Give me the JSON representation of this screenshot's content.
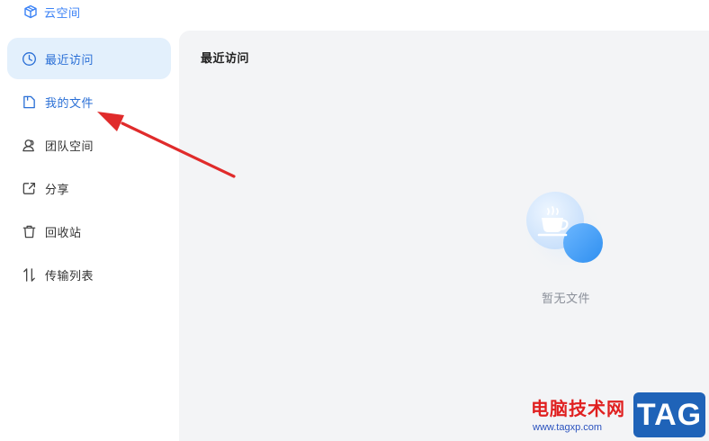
{
  "brand": {
    "title": "云空间",
    "icon": "cube-icon"
  },
  "sidebar": {
    "items": [
      {
        "label": "最近访问",
        "icon": "clock-icon",
        "state": "active"
      },
      {
        "label": "我的文件",
        "icon": "file-icon",
        "state": "highlighted"
      },
      {
        "label": "团队空间",
        "icon": "team-icon"
      },
      {
        "label": "分享",
        "icon": "share-icon"
      },
      {
        "label": "回收站",
        "icon": "trash-icon"
      },
      {
        "label": "传输列表",
        "icon": "transfer-icon"
      }
    ]
  },
  "main": {
    "title": "最近访问",
    "empty_state": {
      "text": "暂无文件",
      "icon": "coffee-cup-icon"
    }
  },
  "annotation": {
    "type": "arrow",
    "color": "#e02b2b",
    "points_to": "我的文件"
  },
  "watermark": {
    "title": "电脑技术网",
    "url": "www.tagxp.com",
    "logo_text": "TAG"
  },
  "colors": {
    "accent": "#2a6fd6",
    "active_bg": "#e3f0fc",
    "main_bg": "#f3f4f6",
    "annotation_red": "#e02b2b"
  }
}
